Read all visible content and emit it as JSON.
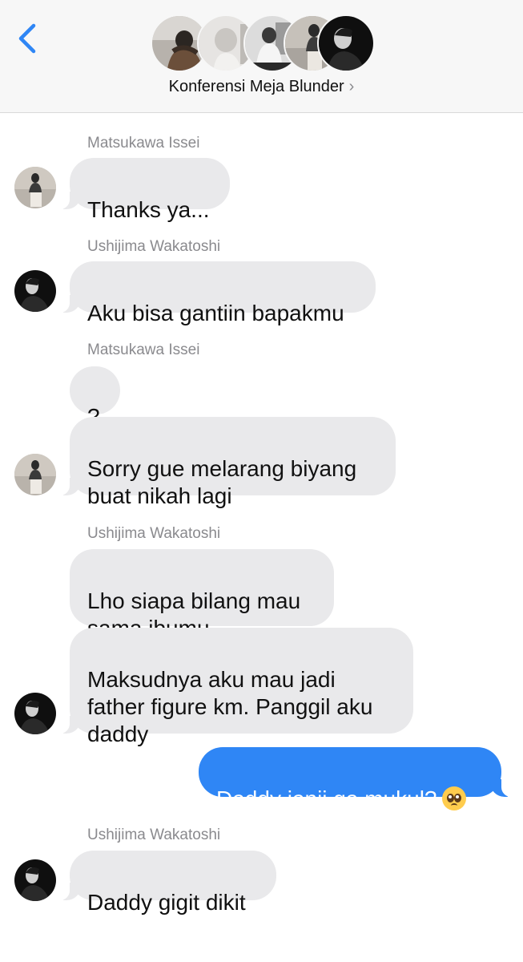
{
  "header": {
    "back_icon": "chevron-left-icon",
    "group_name": "Konferensi Meja Blunder",
    "chevron": "›",
    "accent_color": "#2f86f5"
  },
  "messages": [
    {
      "sender": "Matsukawa Issei",
      "text": "Thanks ya..."
    },
    {
      "sender": "Ushijima Wakatoshi",
      "text": "Aku bisa gantiin bapakmu"
    },
    {
      "sender": "Matsukawa Issei",
      "text": "?"
    },
    {
      "text": "Sorry gue melarang biyang\nbuat nikah lagi"
    },
    {
      "sender": "Ushijima Wakatoshi",
      "text": "Lho siapa bilang mau\nsama ibumu"
    },
    {
      "text": "Maksudnya aku mau jadi\nfather figure km. Panggil aku\ndaddy"
    },
    {
      "text": "Daddy janji ga mukul?",
      "emoji": "pleading-face-icon",
      "outgoing": true
    },
    {
      "sender": "Ushijima Wakatoshi",
      "text": "Daddy gigit dikit"
    }
  ],
  "colors": {
    "incoming_bubble": "#e9e9eb",
    "outgoing_bubble": "#2f86f5",
    "sender_label": "#8a8a8e"
  }
}
